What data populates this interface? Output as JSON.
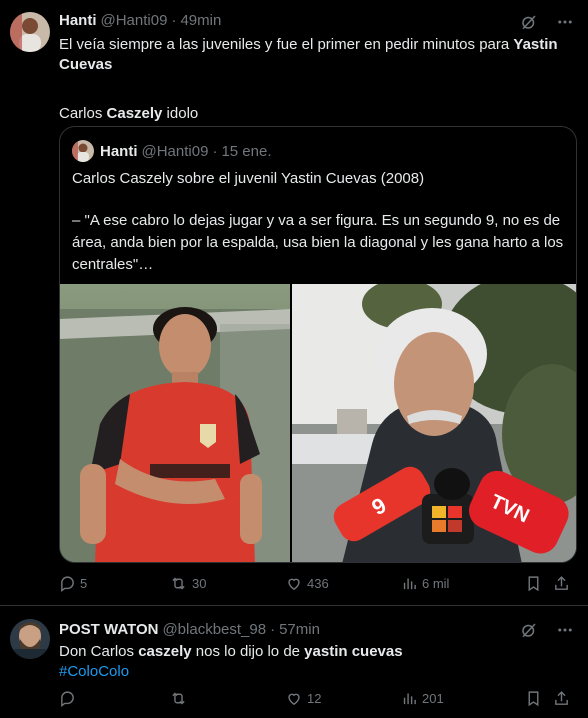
{
  "tweets": [
    {
      "name": "Hanti",
      "handle": "@Hanti09",
      "dot": "·",
      "time": "49min",
      "text_line1_a": "El veía siempre a las juveniles y fue el primer en pedir minutos para ",
      "text_line1_b": "Yastin Cuevas",
      "text_line2_a": "Carlos ",
      "text_line2_b": "Caszely",
      "text_line2_c": " idolo",
      "quote": {
        "name": "Hanti",
        "handle": "@Hanti09",
        "dot": "·",
        "time": "15 ene.",
        "title": "Carlos Caszely sobre el juvenil Yastin Cuevas (2008)",
        "body": "– \"A ese cabro lo dejas jugar y va a ser figura. Es un segundo 9, no es de área, anda bien por la espalda, usa bien la diagonal y les gana harto a los centrales\"…"
      },
      "actions": {
        "replies": "5",
        "retweets": "30",
        "likes": "436",
        "views": "6 mil"
      }
    },
    {
      "name": "POST WATON",
      "handle": "@blackbest_98",
      "dot": "·",
      "time": "57min",
      "text_a": "Don Carlos ",
      "text_b": "caszely",
      "text_c": " nos lo dijo lo de ",
      "text_d": "yastin cuevas",
      "hashtag": "#ColoColo",
      "actions": {
        "replies": "",
        "retweets": "",
        "likes": "12",
        "views": "201"
      }
    }
  ],
  "colors": {
    "background": "#000000",
    "text": "#e7e9ea",
    "muted": "#71767b",
    "link": "#1d9bf0",
    "border": "#2f3336"
  },
  "icons": [
    "grok-icon",
    "more-icon",
    "reply-icon",
    "retweet-icon",
    "like-icon",
    "views-icon",
    "bookmark-icon",
    "share-icon"
  ]
}
